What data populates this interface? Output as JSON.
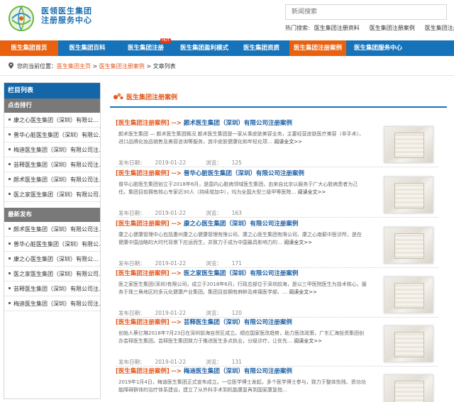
{
  "header": {
    "logo_line1": "医领医生集团",
    "logo_line2": "注册服务中心",
    "search_placeholder": "新闻搜索",
    "hot_label": "热门搜索:",
    "hot_links": [
      "医生集团注册资料",
      "医生集团注册案例",
      "医生集团注册"
    ]
  },
  "nav": {
    "items": [
      {
        "label": "医生集团首页",
        "active": true
      },
      {
        "label": "医生集团百科",
        "active": false
      },
      {
        "label": "医生集团注册",
        "active": false,
        "badge": "HOT"
      },
      {
        "label": "医生集团盈利模式",
        "active": false
      },
      {
        "label": "医生集团资质",
        "active": false
      },
      {
        "label": "医生集团注册案例",
        "active": true
      },
      {
        "label": "医生集团服务中心",
        "active": false
      }
    ]
  },
  "breadcrumb": {
    "prefix": "您的当前位置：",
    "home": "医生集团主页",
    "sep1": " > ",
    "section": "医生集团注册案例",
    "sep2": " > ",
    "current": "文章列表"
  },
  "sidebar": {
    "head": "栏目列表",
    "rank_head": "点击排行",
    "rank_items": [
      "康之心医生集团（深圳）有限公…",
      "普华心脏医生集团（深圳）有限公…",
      "梅迪医生集团（深圳）有限公司注…",
      "芸释医生集团（深圳）有限公司注…",
      "颜术医生集团（深圳）有限公司注…",
      "医之家医生集团（深圳）有限公司…"
    ],
    "latest_head": "最新发布",
    "latest_items": [
      "颜术医生集团（深圳）有限公司注…",
      "普华心脏医生集团（深圳）有限公…",
      "康之心医生集团（深圳）有限公…",
      "医之家医生集团（深圳）有限公司…",
      "芸释医生集团（深圳）有限公司注…",
      "梅迪医生集团（深圳）有限公司注…"
    ]
  },
  "main": {
    "title": "医生集团注册案例",
    "date_label": "发布日期：",
    "views_label": "浏览：",
    "more_label": "阅读全文>>",
    "articles": [
      {
        "cat": "[医生集团注册案例]",
        "arrow": "-->",
        "name": "颜术医生集团（深圳）有限公司注册案例",
        "body": "颜术医生集团 — 颜术医生集团概况 颜术医生集团是一家从事皮肤美容业务，主要经营皮肤医疗美容（非手术）、进口品牌化妆品销售及美容咨询等服务，其中皮肤健康化和年轻化项…",
        "date": "2019-01-22",
        "views": "125"
      },
      {
        "cat": "[医生集团注册案例]",
        "arrow": "-->",
        "name": "普华心脏医生集团（深圳）有限公司注册案例",
        "body": "普华心脏医生集团创立于2018年6月，是国内心脏病领域医生集团，由来自北京以服务于广大心脏病患者为己任。集团目前拥有核心专家近30人（持续增加中），均为全国大型三级甲等医院…",
        "date": "2019-01-22",
        "views": "163"
      },
      {
        "cat": "[医生集团注册案例]",
        "arrow": "-->",
        "name": "康之心医生集团（深圳）有限公司注册案例",
        "body": "康之心健康管理中心包括惠州康之心健康管理有限公司、康之心医生集团有限公司、康之心南蓟中医诊所，是在 健康中国战略的大时代背景下应运而生，并致力于成为中国最具影响力的…",
        "date": "2019-01-22",
        "views": "171"
      },
      {
        "cat": "[医生集团注册案例]",
        "arrow": "-->",
        "name": "医之家医生集团（深圳）有限公司注册案例",
        "body": "医之家医生集团(深圳)有限公司，成立于2018年6月，行政总部位于深圳前海，是以三甲医院医生为技术核心，服务于珠三角地区的多元化健康产业集团。集团目前拥有麻醉及疼痛医学部、…",
        "date": "2019-01-22",
        "views": "120"
      },
      {
        "cat": "[医生集团注册案例]",
        "arrow": "-->",
        "name": "芸释医生集团（深圳）有限公司注册案例",
        "body": "创始人蔡亿琳2018年7月23日在深圳前海自贸区成立。顺应国家医改趋势，助力医改政策，广东汇海投资集团创办芸释医生集团。芸释医生集团致力于推进医生多点执业，分级诊疗，让优先…",
        "date": "2019-01-22",
        "views": "131"
      },
      {
        "cat": "[医生集团注册案例]",
        "arrow": "-->",
        "name": "梅迪医生集团（深圳）有限公司注册案例",
        "body": "2019年1月4日，梅迪医生集团正式宣布成立。一位医学博士发起，多个医学博士参与，致力于整体伤残、资功功能障碍群体的治疗体系建设，建立了从外科手术到机能康复再到国家康复指…",
        "date": "2019-01-22",
        "views": "131"
      }
    ]
  }
}
